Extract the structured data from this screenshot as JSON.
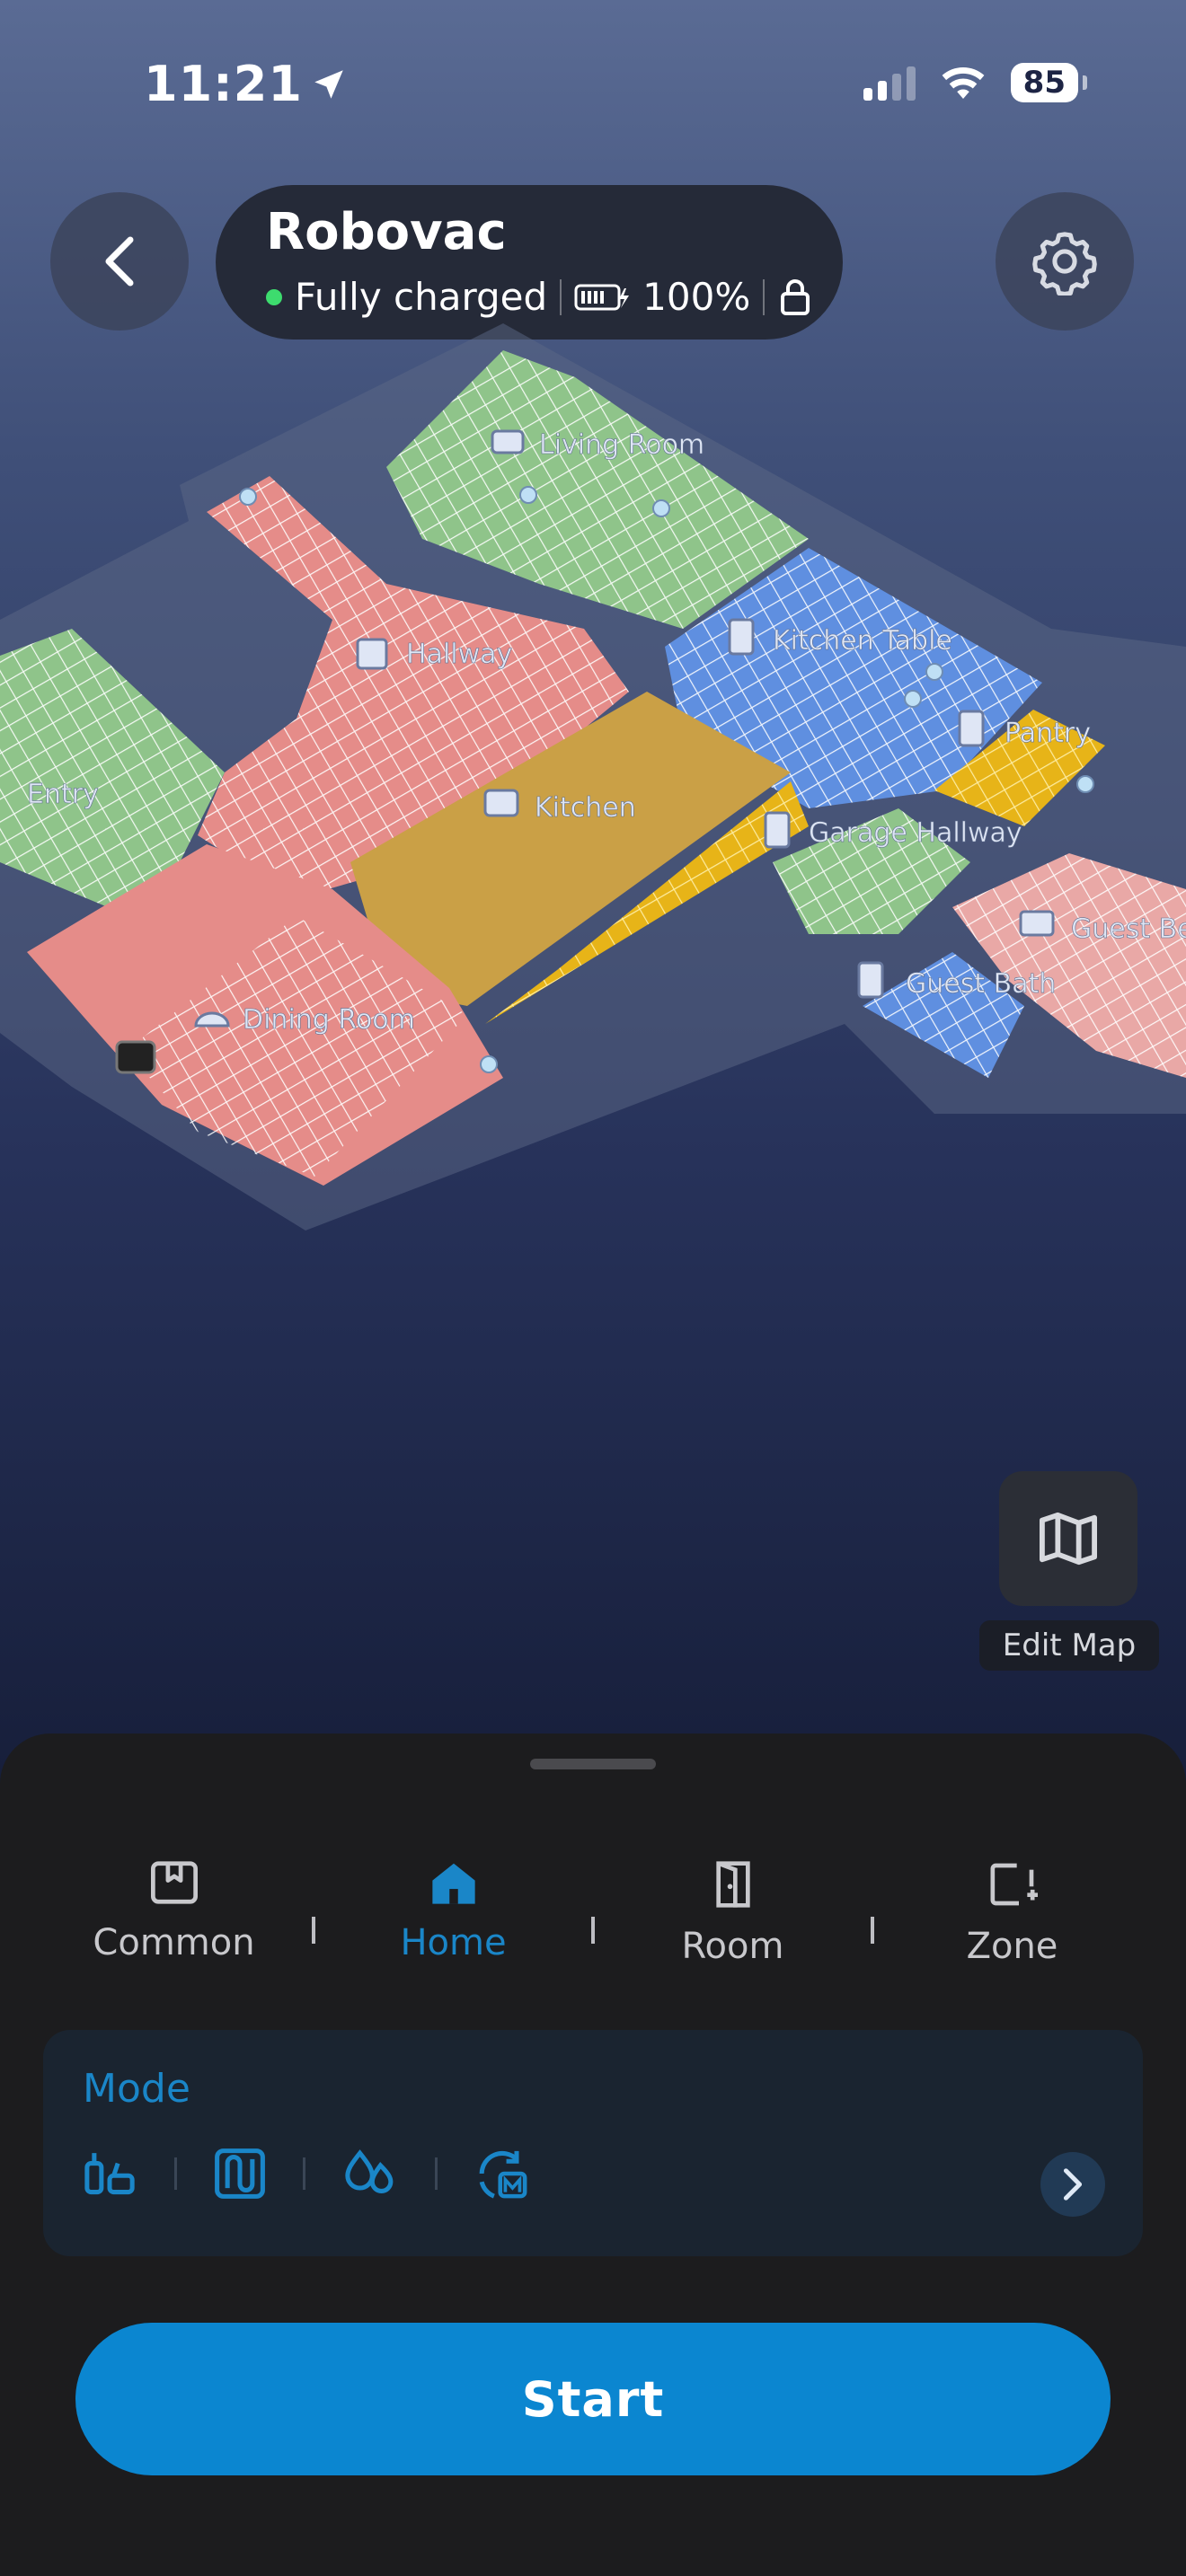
{
  "status_bar": {
    "time": "11:21",
    "battery": "85"
  },
  "device": {
    "name": "Robovac",
    "status": "Fully charged",
    "battery": "100%"
  },
  "map": {
    "rooms": [
      "Living Room",
      "Hallway",
      "Kitchen Table",
      "Pantry",
      "Entry",
      "Kitchen",
      "Garage Hallway",
      "Guest Be",
      "Guest Bath",
      "Dining Room"
    ]
  },
  "edit_map_label": "Edit Map",
  "tabs": [
    {
      "label": "Common",
      "icon": "bookmark-icon"
    },
    {
      "label": "Home",
      "icon": "home-icon"
    },
    {
      "label": "Room",
      "icon": "door-icon"
    },
    {
      "label": "Zone",
      "icon": "zone-add-icon"
    }
  ],
  "active_tab": "Home",
  "mode": {
    "title": "Mode",
    "icons": [
      "suction-icon",
      "mop-route-icon",
      "water-level-icon",
      "mop-mode-icon"
    ]
  },
  "start_label": "Start",
  "colors": {
    "accent": "#0b86d0",
    "charged_dot": "#3ddc6e",
    "sheet_bg": "#1c1c1e"
  }
}
